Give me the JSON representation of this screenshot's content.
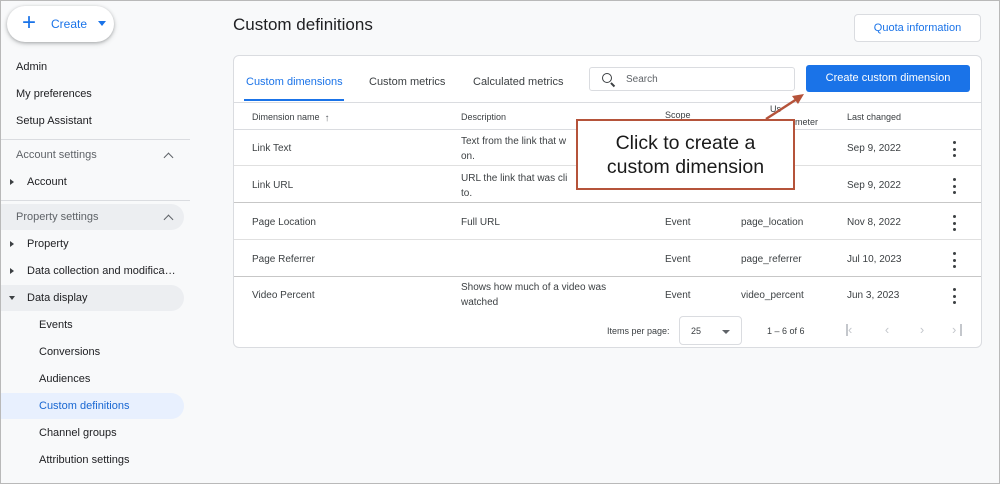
{
  "sidebar": {
    "create_label": "Create",
    "items": {
      "admin": "Admin",
      "my_preferences": "My preferences",
      "setup_assistant": "Setup Assistant",
      "account_settings": "Account settings",
      "account": "Account",
      "property_settings": "Property settings",
      "property": "Property",
      "data_collection": "Data collection and modifica…",
      "data_display": "Data display",
      "events": "Events",
      "conversions": "Conversions",
      "audiences": "Audiences",
      "custom_definitions": "Custom definitions",
      "channel_groups": "Channel groups",
      "attribution_settings": "Attribution settings"
    }
  },
  "header": {
    "title": "Custom definitions",
    "quota_button": "Quota information"
  },
  "tabs": {
    "custom_dimensions": "Custom dimensions",
    "custom_metrics": "Custom metrics",
    "calculated_metrics": "Calculated metrics"
  },
  "search": {
    "placeholder": "Search"
  },
  "create_button": "Create custom dimension",
  "table": {
    "columns": {
      "name": "Dimension name",
      "description": "Description",
      "scope": "Scope",
      "user_param_top": "Us",
      "user_param_bottom": "meter",
      "last_changed": "Last changed"
    },
    "rows": [
      {
        "name": "Link Text",
        "description": "Text from the link that w on.",
        "scope": "",
        "param": "",
        "date": "Sep 9, 2022"
      },
      {
        "name": "Link URL",
        "description": "URL the link that was cli to.",
        "scope": "",
        "param": "",
        "date": "Sep 9, 2022"
      },
      {
        "name": "Page Location",
        "description": "Full URL",
        "scope": "Event",
        "param": "page_location",
        "date": "Nov 8, 2022"
      },
      {
        "name": "Page Referrer",
        "description": "",
        "scope": "Event",
        "param": "page_referrer",
        "date": "Jul 10, 2023"
      },
      {
        "name": "Video Percent",
        "description": "Shows how much of a video was watched",
        "scope": "Event",
        "param": "video_percent",
        "date": "Jun 3, 2023"
      }
    ]
  },
  "pagination": {
    "items_per_page_label": "Items per page:",
    "items_per_page_value": "25",
    "range": "1 – 6 of 6"
  },
  "callout": {
    "line1": "Click to create a",
    "line2": "custom dimension"
  },
  "colors": {
    "accent": "#1a73e8",
    "callout_border": "#b5533a"
  }
}
